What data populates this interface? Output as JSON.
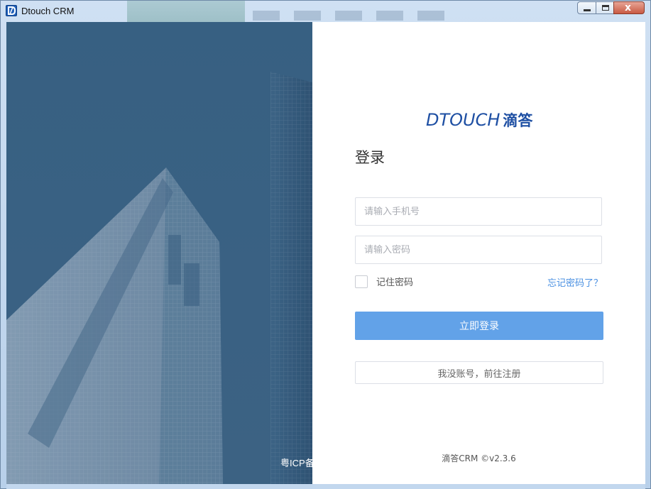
{
  "window": {
    "title": "Dtouch CRM",
    "close_glyph": "x"
  },
  "left": {
    "icp_text": "粤ICP备"
  },
  "login": {
    "logo_text": "DTOUCH",
    "logo_cn": "滴答",
    "heading": "登录",
    "phone_placeholder": "请输入手机号",
    "password_placeholder": "请输入密码",
    "remember_label": "记住密码",
    "forgot_link": "忘记密码了？",
    "submit_label": "立即登录",
    "register_label": "我没账号，前往注册",
    "footer": "滴答CRM ©v2.3.6"
  },
  "colors": {
    "accent": "#62a2e8",
    "brand": "#1e4fa3",
    "link": "#4a90e2"
  }
}
